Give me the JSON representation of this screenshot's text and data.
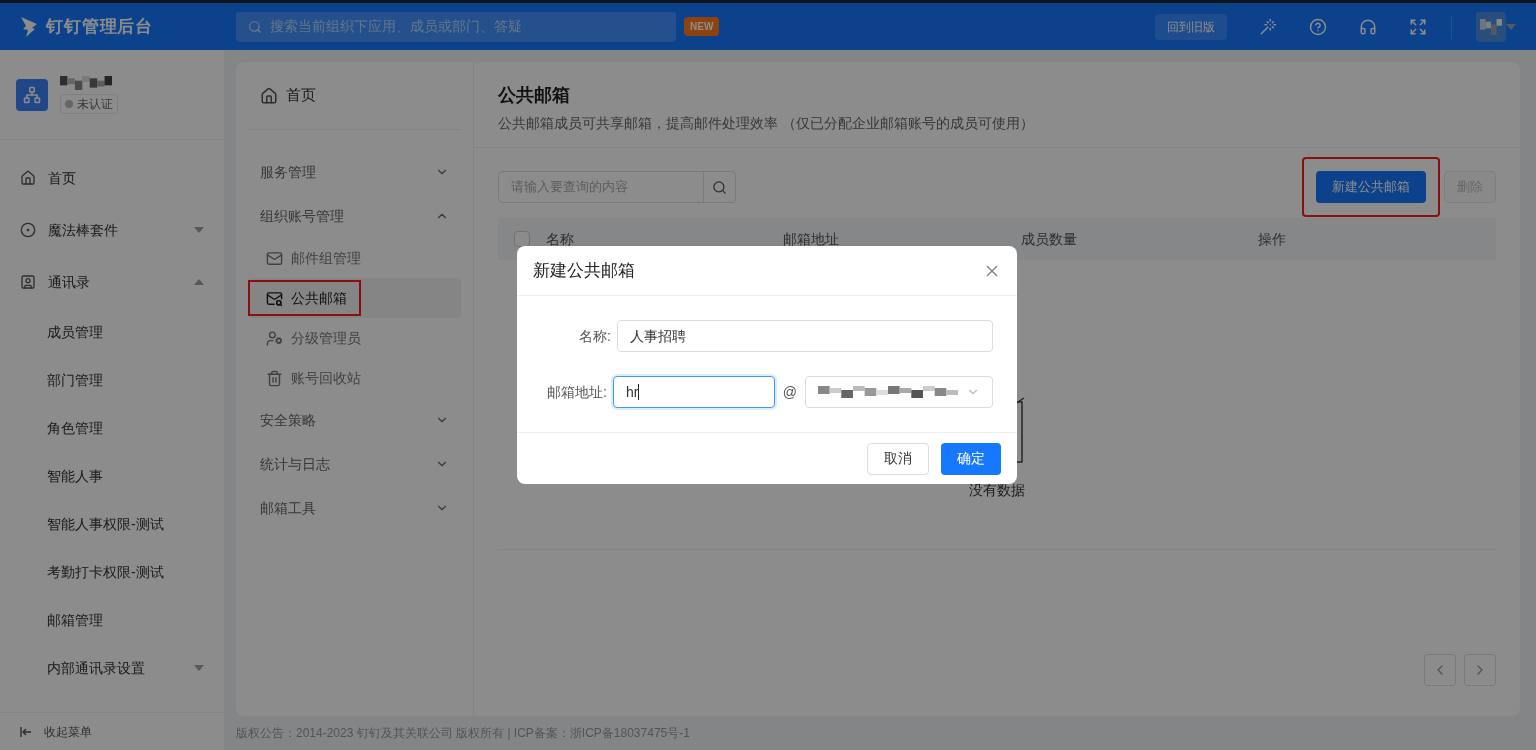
{
  "header": {
    "logo_text": "钉钉管理后台",
    "search_placeholder": "搜索当前组织下应用、成员或部门、答疑",
    "new_badge": "NEW",
    "old_version_button": "回到旧版"
  },
  "sidebar": {
    "org_status": "未认证",
    "items": [
      {
        "label": "首页",
        "kind": "link"
      },
      {
        "label": "魔法棒套件",
        "kind": "group",
        "expanded": false
      },
      {
        "label": "通讯录",
        "kind": "group",
        "expanded": true,
        "children": [
          {
            "label": "成员管理",
            "kind": "link"
          },
          {
            "label": "部门管理",
            "kind": "link"
          },
          {
            "label": "角色管理",
            "kind": "link"
          },
          {
            "label": "智能人事",
            "kind": "link"
          },
          {
            "label": "智能人事权限-测试",
            "kind": "link"
          },
          {
            "label": "考勤打卡权限-测试",
            "kind": "link"
          },
          {
            "label": "邮箱管理",
            "kind": "link"
          },
          {
            "label": "内部通讯录设置",
            "kind": "group",
            "expanded": false
          }
        ]
      }
    ],
    "collapse_label": "收起菜单"
  },
  "subnav": {
    "home": "首页",
    "sections": [
      {
        "label": "服务管理",
        "expanded": false
      },
      {
        "label": "组织账号管理",
        "expanded": true,
        "children": [
          {
            "label": "邮件组管理",
            "selected": false,
            "highlighted": false
          },
          {
            "label": "公共邮箱",
            "selected": true,
            "highlighted": true
          },
          {
            "label": "分级管理员",
            "selected": false,
            "highlighted": false
          },
          {
            "label": "账号回收站",
            "selected": false,
            "highlighted": false
          }
        ]
      },
      {
        "label": "安全策略",
        "expanded": false
      },
      {
        "label": "统计与日志",
        "expanded": false
      },
      {
        "label": "邮箱工具",
        "expanded": false
      }
    ]
  },
  "main": {
    "title": "公共邮箱",
    "description": "公共邮箱成员可共享邮箱，提高邮件处理效率 （仅已分配企业邮箱账号的成员可使用）",
    "search_placeholder": "请输入要查询的内容",
    "new_button": {
      "label": "新建公共邮箱",
      "highlighted": true
    },
    "delete_button": {
      "label": "删除",
      "disabled": true
    },
    "table": {
      "select_all_checked": false,
      "columns": [
        "名称",
        "邮箱地址",
        "成员数量",
        "操作"
      ]
    },
    "empty_text": "没有数据"
  },
  "modal": {
    "title": "新建公共邮箱",
    "name_label": "名称:",
    "name_value": "人事招聘",
    "address_label": "邮箱地址:",
    "address_value": "hr",
    "address_focused": true,
    "at_sign": "@",
    "cancel": "取消",
    "confirm": "确定"
  },
  "footer": "版权公告：2014-2023 钉钉及其关联公司 版权所有 | ICP备案：浙ICP备18037475号-1"
}
